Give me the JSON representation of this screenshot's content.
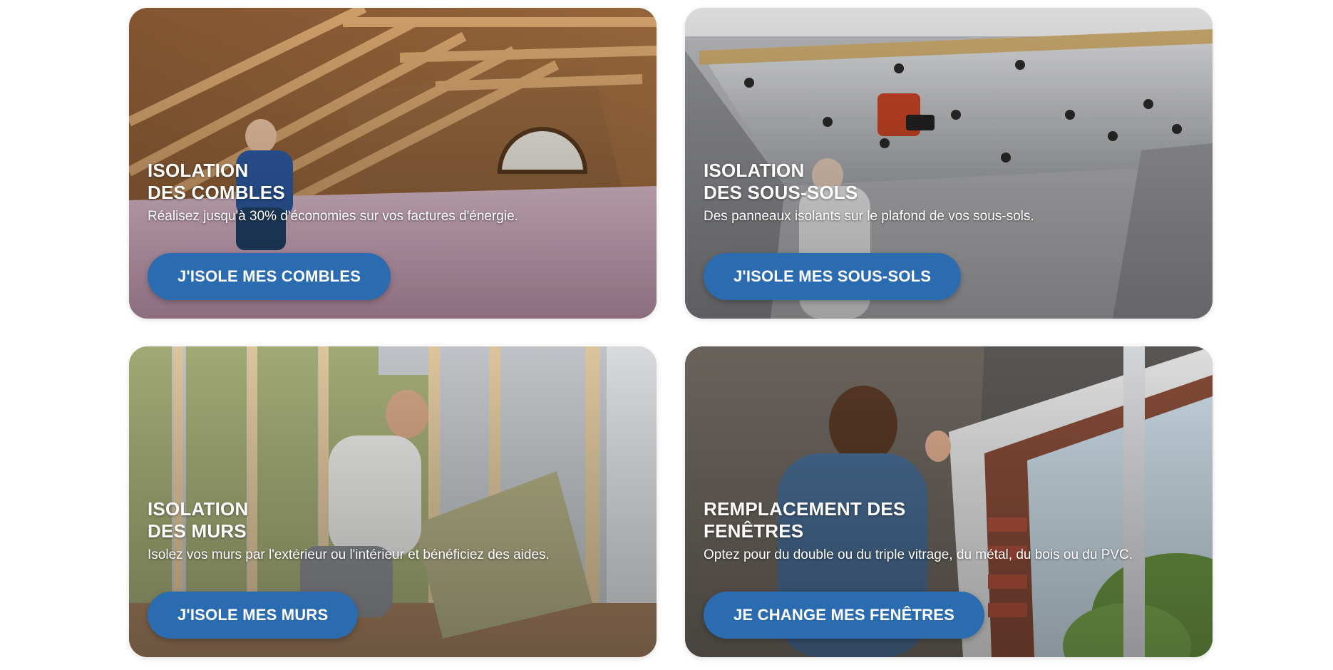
{
  "cards": [
    {
      "title_line1": "ISOLATION",
      "title_line2": "DES COMBLES",
      "description": "Réalisez jusqu'à 30% d'économies sur vos factures d'énergie.",
      "button_label": "J'ISOLE MES COMBLES",
      "image": "attic-insulation-photo"
    },
    {
      "title_line1": "ISOLATION",
      "title_line2": "DES SOUS-SOLS",
      "description": "Des panneaux isolants sur le plafond de vos sous-sols.",
      "button_label": "J'ISOLE MES SOUS-SOLS",
      "image": "basement-ceiling-insulation-photo"
    },
    {
      "title_line1": "ISOLATION",
      "title_line2": "DES MURS",
      "description": "Isolez vos murs par l'extérieur ou l'intérieur et bénéficiez des aides.",
      "button_label": "J'ISOLE MES MURS",
      "image": "wall-insulation-photo"
    },
    {
      "title_line1": "REMPLACEMENT DES",
      "title_line2": "FENÊTRES",
      "description": "Optez pour du double ou du triple vitrage, du métal, du bois ou du PVC.",
      "button_label": "JE CHANGE MES FENÊTRES",
      "image": "window-replacement-photo"
    }
  ],
  "colors": {
    "button_bg": "#2b6cb0",
    "text": "#ffffff",
    "page_bg": "#ffffff"
  }
}
